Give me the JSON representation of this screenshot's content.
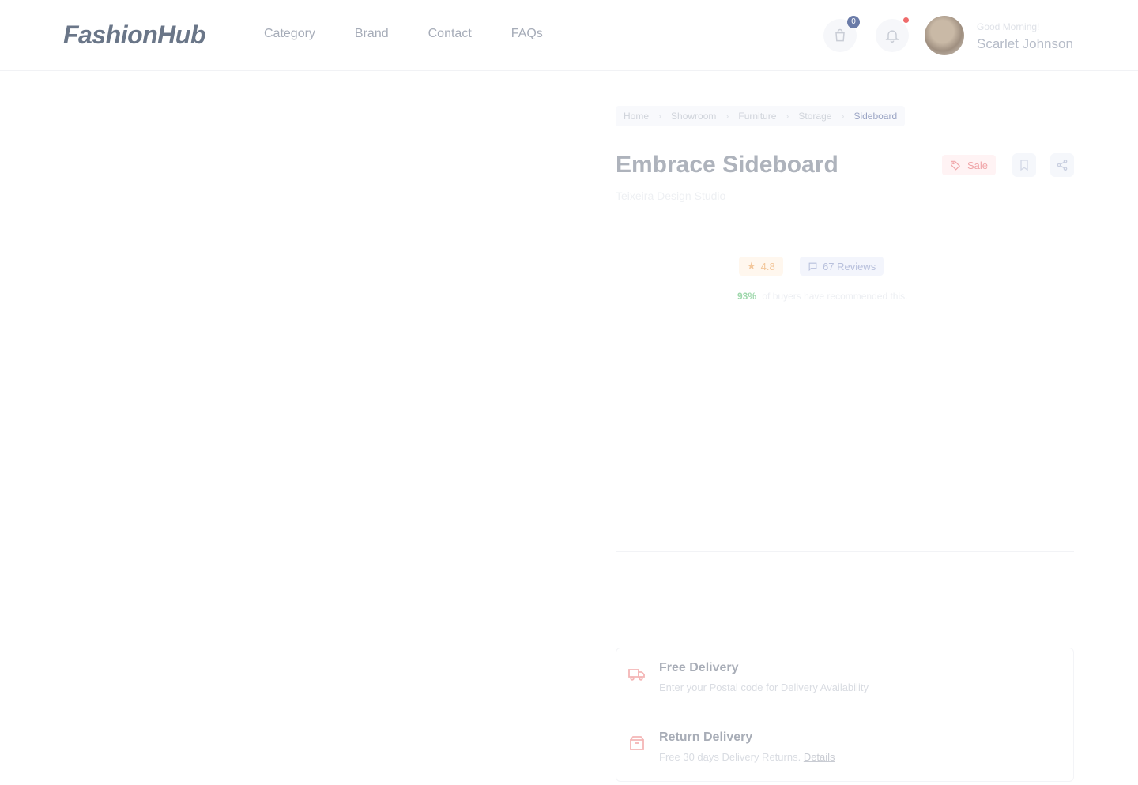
{
  "header": {
    "logo": "FashionHub",
    "nav": [
      "Category",
      "Brand",
      "Contact",
      "FAQs"
    ],
    "cart_count": "0",
    "user_greeting": "Good Morning!",
    "user_name": "Scarlet Johnson"
  },
  "breadcrumb": [
    "Home",
    "Showroom",
    "Furniture",
    "Storage",
    "Sideboard"
  ],
  "product": {
    "title": "Embrace Sideboard",
    "subtitle": "Teixeira Design Studio",
    "sale_label": "Sale",
    "rating": "4.8",
    "reviews": "67 Reviews",
    "recommend_pct": "93%",
    "recommend_text": "of buyers have recommended this."
  },
  "delivery": [
    {
      "icon": "truck-icon",
      "title": "Free Delivery",
      "desc": "Enter your Postal code for Delivery Availability"
    },
    {
      "icon": "return-box-icon",
      "title": "Return Delivery",
      "desc": "Free 30 days Delivery Returns.",
      "link": "Details"
    }
  ],
  "colors": {
    "accent": "#6a7ba8",
    "sale": "#ef6b6b",
    "star": "#f3a04d",
    "recommend": "#3fb660"
  }
}
